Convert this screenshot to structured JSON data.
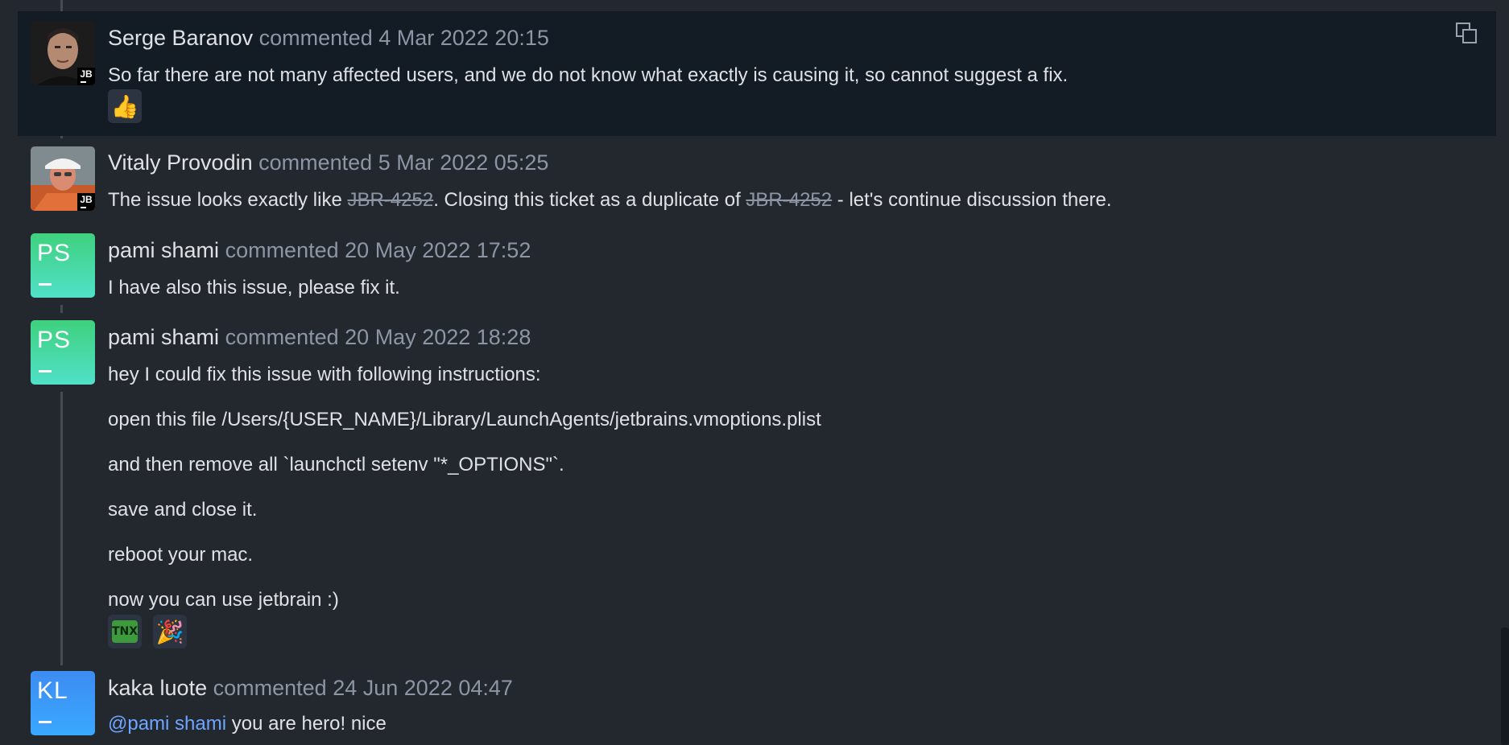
{
  "comments": [
    {
      "author": "Serge Baranov",
      "verb": "commented",
      "date": "4 Mar 2022 20:15",
      "badge": "JB",
      "lines": [
        "So far there are not many affected users, and we do not know what exactly is causing it, so cannot suggest a fix."
      ],
      "reactions": [
        "thumbs-up"
      ]
    },
    {
      "author": "Vitaly Provodin",
      "verb": "commented",
      "date": "5 Mar 2022 05:25",
      "badge": "JB",
      "text_before": "The issue looks exactly like ",
      "link1": "JBR-4252",
      "text_mid": ". Closing this ticket as a duplicate of ",
      "link2": "JBR-4252",
      "text_after": " - let's continue discussion there."
    },
    {
      "author": "pami shami",
      "initials": "PS",
      "verb": "commented",
      "date": "20 May 2022 17:52",
      "lines": [
        "I have also this issue, please fix it."
      ]
    },
    {
      "author": "pami shami",
      "initials": "PS",
      "verb": "commented",
      "date": "20 May 2022 18:28",
      "lines": [
        "hey I could fix this issue with following instructions:",
        "open this file /Users/{USER_NAME}/Library/LaunchAgents/jetbrains.vmoptions.plist",
        "and then remove all `launchctl setenv \"*_OPTIONS\"`.",
        "save and close it.",
        "reboot your mac.",
        "now you can use jetbrain :)"
      ],
      "reactions": [
        "TNX",
        "party-popper"
      ]
    },
    {
      "author": "kaka luote",
      "initials": "KL",
      "verb": "commented",
      "date": "24 Jun 2022 04:47",
      "mention": "@pami shami",
      "text_after": " you are hero! nice"
    }
  ],
  "colors": {
    "background": "#23272e",
    "highlight": "#131b25",
    "muted": "#8c96a5",
    "mention": "#6ea6ff"
  }
}
